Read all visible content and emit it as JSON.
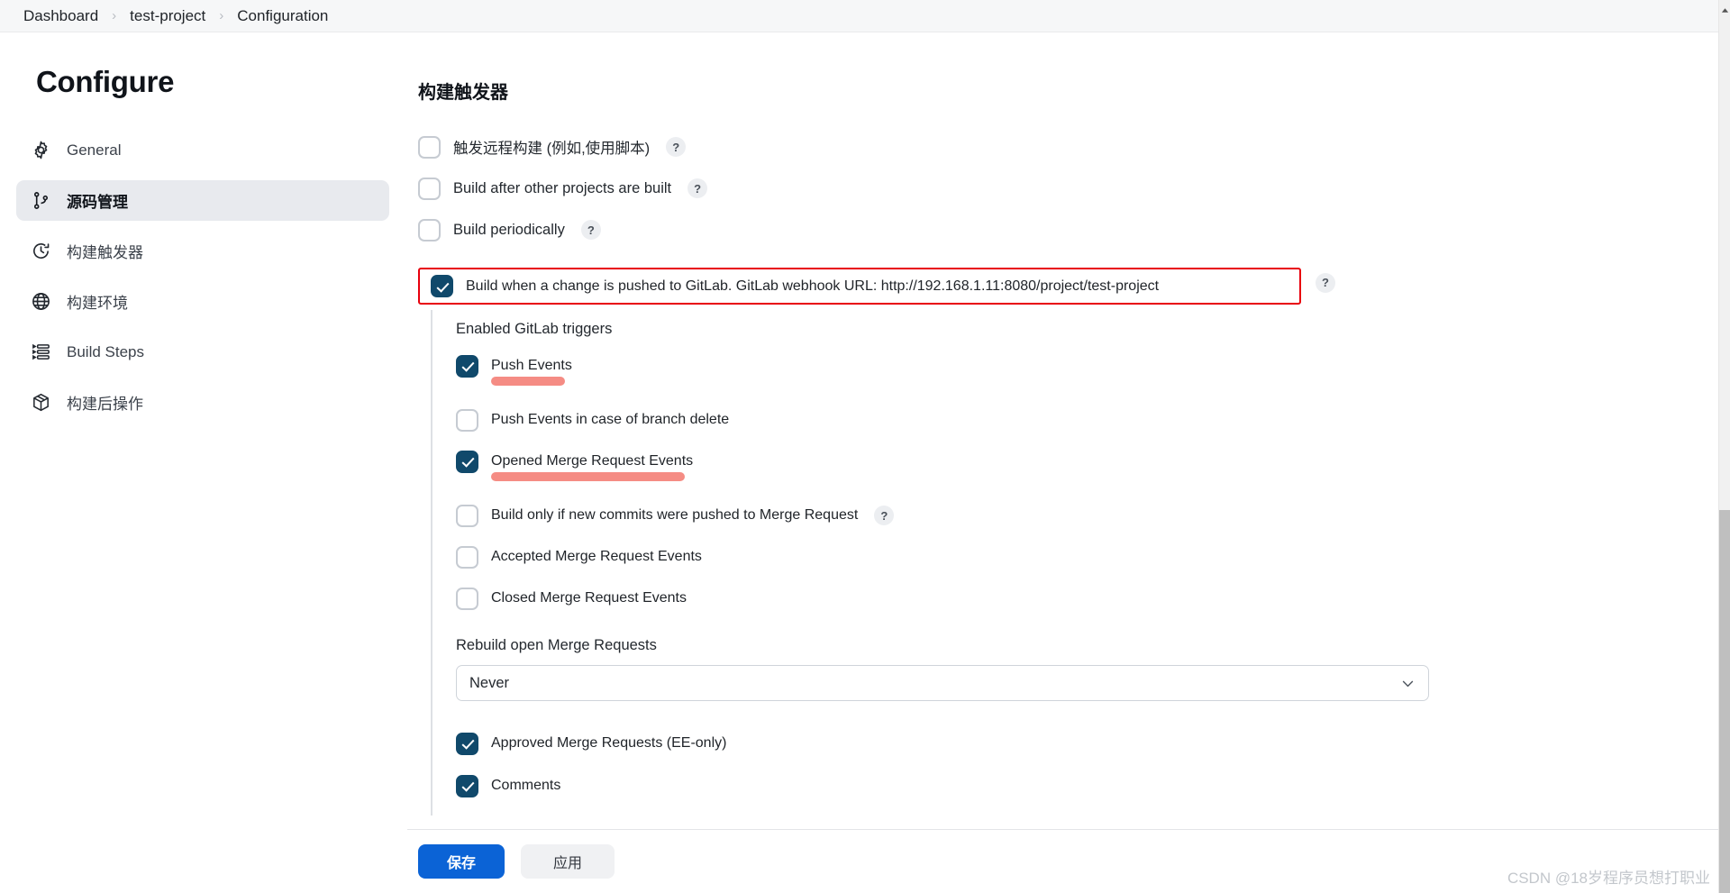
{
  "breadcrumb": {
    "items": [
      {
        "label": "Dashboard"
      },
      {
        "label": "test-project"
      },
      {
        "label": "Configuration"
      }
    ],
    "separator": "›"
  },
  "sidebar": {
    "title": "Configure",
    "items": [
      {
        "label": "General",
        "icon": "gear-icon",
        "active": false
      },
      {
        "label": "源码管理",
        "icon": "git-branch-icon",
        "active": true
      },
      {
        "label": "构建触发器",
        "icon": "clock-icon",
        "active": false
      },
      {
        "label": "构建环境",
        "icon": "globe-icon",
        "active": false
      },
      {
        "label": "Build Steps",
        "icon": "list-steps-icon",
        "active": false
      },
      {
        "label": "构建后操作",
        "icon": "package-icon",
        "active": false
      }
    ]
  },
  "main": {
    "section_title": "构建触发器",
    "help_label": "?",
    "triggers": [
      {
        "label": "触发远程构建 (例如,使用脚本)",
        "checked": false,
        "help": true
      },
      {
        "label": "Build after other projects are built",
        "checked": false,
        "help": true
      },
      {
        "label": "Build periodically",
        "checked": false,
        "help": true
      }
    ],
    "gitlab_trigger": {
      "label": "Build when a change is pushed to GitLab. GitLab webhook URL: http://192.168.1.11:8080/project/test-project",
      "checked": true,
      "help": true,
      "highlight_border_color": "#e8000d"
    },
    "enabled_triggers_title": "Enabled GitLab triggers",
    "enabled_triggers": [
      {
        "label": "Push Events",
        "checked": true,
        "help": false,
        "highlight": true,
        "highlight_width": 82
      },
      {
        "label": "Push Events in case of branch delete",
        "checked": false,
        "help": false,
        "highlight": false
      },
      {
        "label": "Opened Merge Request Events",
        "checked": true,
        "help": false,
        "highlight": true,
        "highlight_width": 215
      },
      {
        "label": "Build only if new commits were pushed to Merge Request",
        "checked": false,
        "help": true,
        "highlight": false
      },
      {
        "label": "Accepted Merge Request Events",
        "checked": false,
        "help": false,
        "highlight": false
      },
      {
        "label": "Closed Merge Request Events",
        "checked": false,
        "help": false,
        "highlight": false
      }
    ],
    "rebuild_field": {
      "label": "Rebuild open Merge Requests",
      "value": "Never"
    },
    "tail_triggers": [
      {
        "label": "Approved Merge Requests (EE-only)",
        "checked": true
      },
      {
        "label": "Comments",
        "checked": true
      }
    ],
    "highlight_color": "#f58c84"
  },
  "footer": {
    "save_label": "保存",
    "apply_label": "应用",
    "save_color": "#0b63d6"
  },
  "watermark": "CSDN @18岁程序员想打职业"
}
